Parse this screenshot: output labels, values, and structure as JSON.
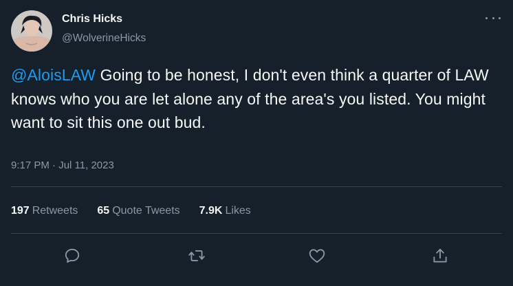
{
  "tweet": {
    "author": {
      "display_name": "Chris Hicks",
      "handle": "@WolverineHicks",
      "avatar_icon": "user-avatar"
    },
    "text": {
      "mention": "@AloisLAW",
      "body": " Going to be honest, I don't even think a quarter of LAW knows who you are let alone any of the area's you listed. You might want to sit this one out bud."
    },
    "timestamp": "9:17 PM · Jul 11, 2023",
    "stats": {
      "retweets_count": "197",
      "retweets_label": "Retweets",
      "quote_count": "65",
      "quote_label": "Quote Tweets",
      "likes_count": "7.9K",
      "likes_label": "Likes"
    },
    "actions": [
      "reply-icon",
      "retweet-icon",
      "like-icon",
      "share-icon"
    ]
  },
  "colors": {
    "background": "#15202b",
    "text_primary": "#f7f9f9",
    "text_secondary": "#8b98a5",
    "accent": "#1d9bf0",
    "divider": "#38444d"
  }
}
